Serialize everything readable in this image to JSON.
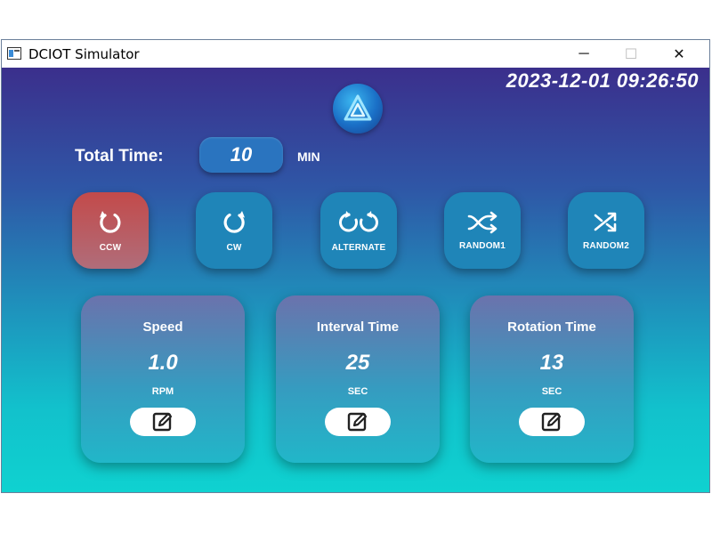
{
  "window": {
    "title": "DCIOT Simulator",
    "controls": {
      "minimize": "─",
      "maximize": "☐",
      "close": "✕"
    }
  },
  "header": {
    "datetime": "2023-12-01 09:26:50"
  },
  "total_time": {
    "label": "Total Time:",
    "value": "10",
    "unit": "MIN"
  },
  "modes": [
    {
      "label": "CCW",
      "icon": "rotate-ccw-icon",
      "active": true
    },
    {
      "label": "CW",
      "icon": "rotate-cw-icon",
      "active": false
    },
    {
      "label": "ALTERNATE",
      "icon": "alternate-icon",
      "active": false
    },
    {
      "label": "RANDOM1",
      "icon": "shuffle-icon",
      "active": false
    },
    {
      "label": "RANDOM2",
      "icon": "shuffle-icon",
      "active": false
    }
  ],
  "cards": [
    {
      "title": "Speed",
      "value": "1.0",
      "unit": "RPM"
    },
    {
      "title": "Interval Time",
      "value": "25",
      "unit": "SEC"
    },
    {
      "title": "Rotation Time",
      "value": "13",
      "unit": "SEC"
    }
  ],
  "colors": {
    "active_mode": "#c34a4a",
    "gradient_top": "#3b2f8c",
    "gradient_bottom": "#0fd2d0"
  }
}
